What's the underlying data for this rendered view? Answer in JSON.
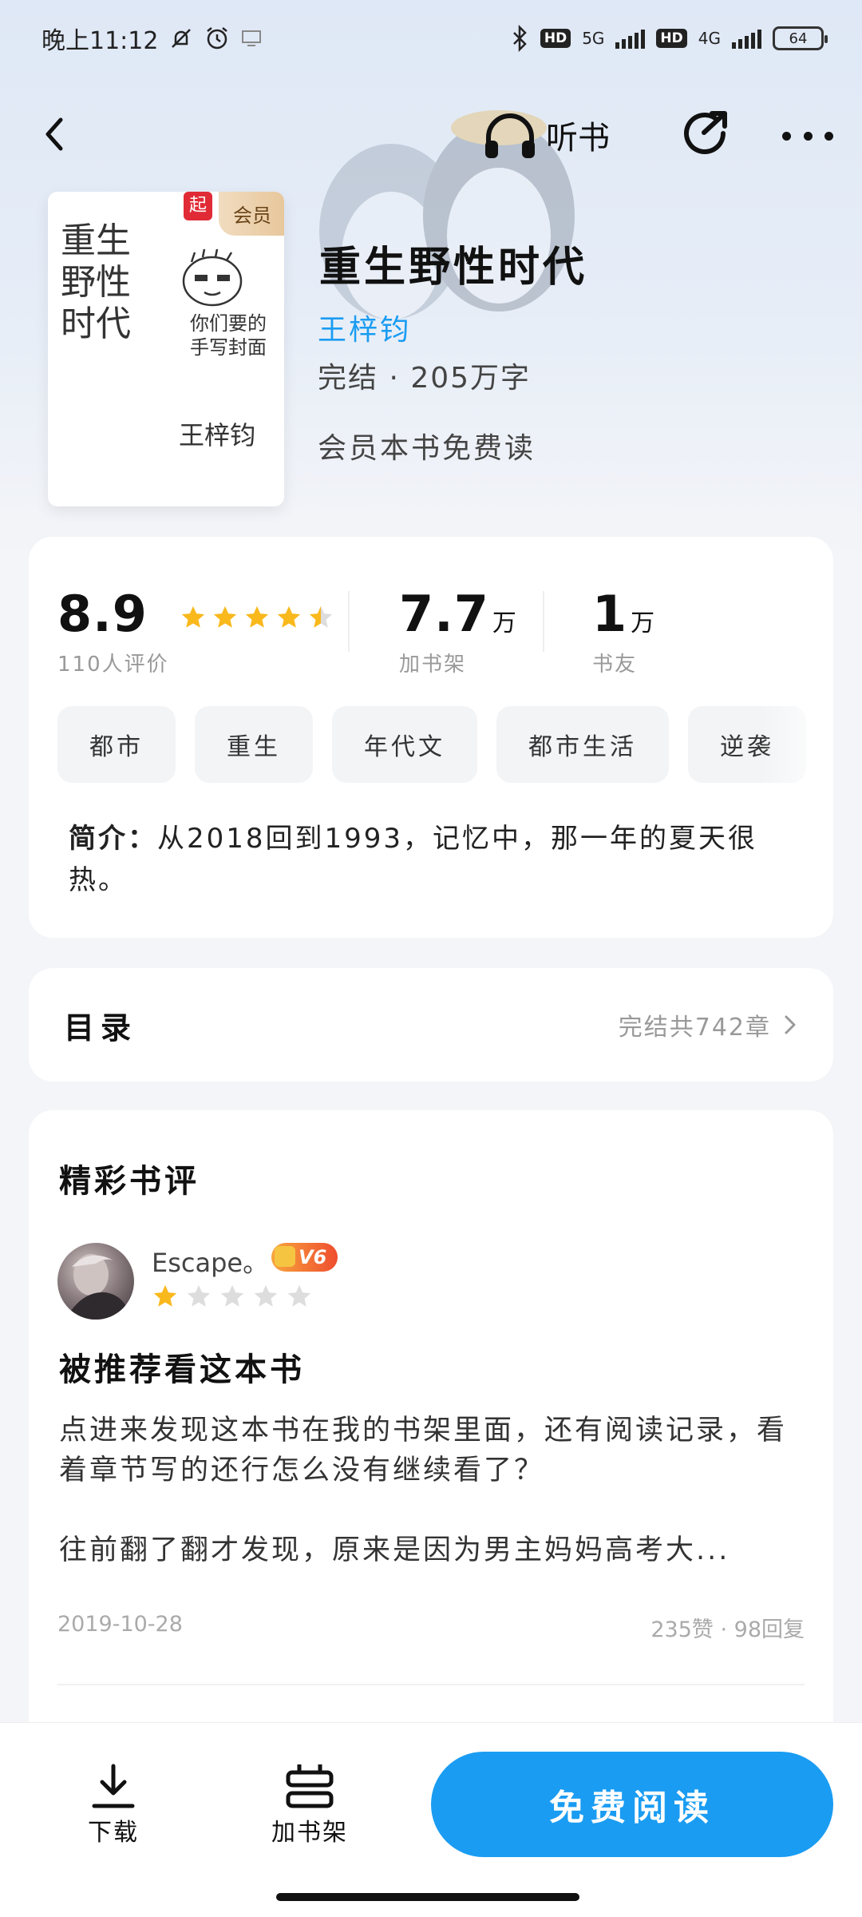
{
  "status_bar": {
    "time": "晚上11:12",
    "network_5g": "5G",
    "network_4g": "4G",
    "hd": "HD",
    "battery": "64"
  },
  "nav": {
    "listen_label": "听书"
  },
  "book": {
    "cover_vip": "会员",
    "cover_logo": "起",
    "cover_handwriting_title": "重生野性时代",
    "cover_handwriting_note": "你们要的手写封面",
    "cover_handwriting_author": "王梓钧",
    "title": "重生野性时代",
    "author": "王梓钧",
    "meta": "完结 · 205万字",
    "vip_note": "会员本书免费读"
  },
  "stats": {
    "rating": "8.9",
    "rating_label": "110人评价",
    "rating_stars": 4.5,
    "shelf_value": "7.7",
    "shelf_unit": "万",
    "shelf_label": "加书架",
    "friends_value": "1",
    "friends_unit": "万",
    "friends_label": "书友"
  },
  "tags": [
    "都市",
    "重生",
    "年代文",
    "都市生活",
    "逆袭"
  ],
  "intro": {
    "label": "简介：",
    "text": "从2018回到1993，记忆中，那一年的夏天很热。"
  },
  "toc": {
    "title": "目录",
    "summary": "完结共742章"
  },
  "reviews": {
    "heading": "精彩书评",
    "items": [
      {
        "user": "Escape。",
        "level": "V6",
        "stars": 1,
        "title": "被推荐看这本书",
        "paragraph1": "点进来发现这本书在我的书架里面，还有阅读记录，看着章节写的还行怎么没有继续看了？",
        "paragraph2": "往前翻了翻才发现，原来是因为男主妈妈高考大...",
        "date": "2019-10-28",
        "stats": "235赞 · 98回复"
      }
    ]
  },
  "bottom_bar": {
    "download_label": "下载",
    "shelf_label": "加书架",
    "read_label": "免费阅读"
  },
  "colors": {
    "accent": "#1a9cf2",
    "star": "#f9b81c",
    "star_empty": "#dddddd"
  }
}
